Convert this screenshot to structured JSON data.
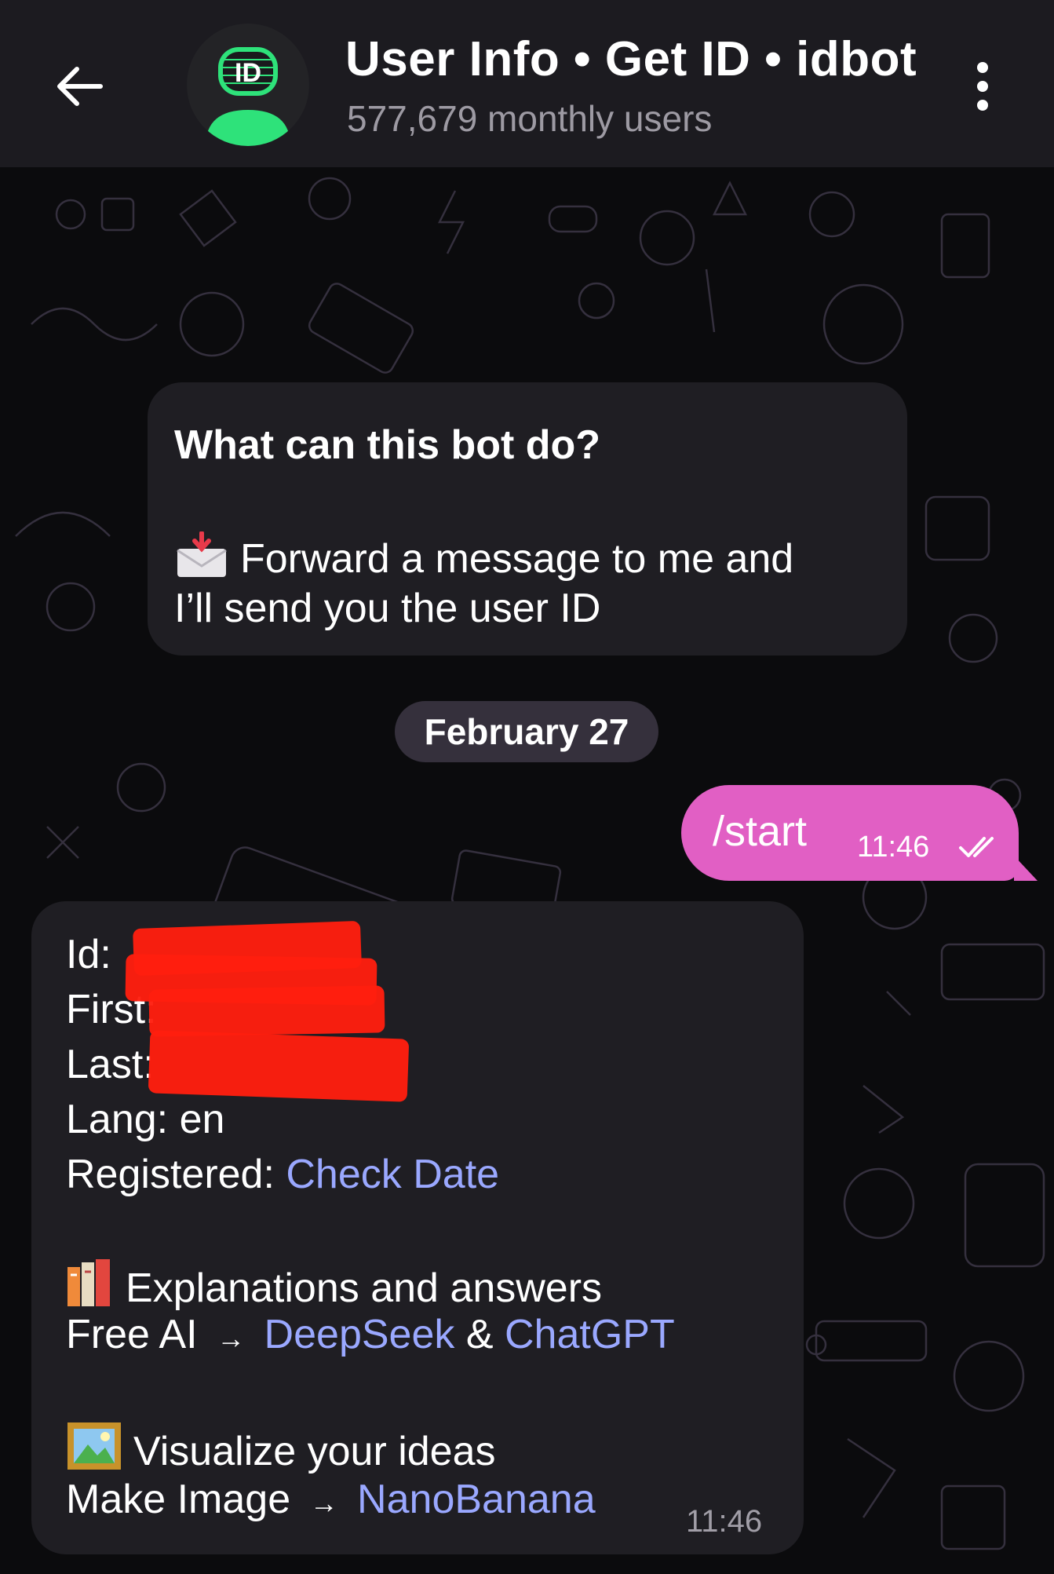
{
  "header": {
    "title": "User Info • Get ID • idbot",
    "subtitle": "577,679 monthly users",
    "avatar_text": "ID",
    "back_icon": "arrow-left-icon",
    "menu_icon": "more-vertical-icon"
  },
  "intro": {
    "title": "What can this bot do?",
    "line1": "Forward a message to me and",
    "line2": "I’ll send you the user ID",
    "icon": "envelope-arrow-icon"
  },
  "date_chip": "February 27",
  "outgoing": {
    "text": "/start",
    "time": "11:46",
    "status_icon": "double-check-icon"
  },
  "reply": {
    "id_label": "Id:",
    "first_label": "First:",
    "last_label": "Last:",
    "lang_label": "Lang: en",
    "registered_label": "Registered:",
    "registered_link": "Check Date",
    "explanations": "Explanations and answers",
    "free_ai_label": "Free AI",
    "arrow": "→",
    "deepseek_link": "DeepSeek",
    "amp": "&",
    "chatgpt_link": "ChatGPT",
    "visualize": "Visualize your ideas",
    "make_image_label": "Make Image",
    "nanobanana_link": "NanoBanana",
    "time": "11:46"
  },
  "colors": {
    "header_bg": "#1c1b20",
    "bubble_bg": "#1f1e23",
    "outgoing_bg": "#e15fc4",
    "link": "#9aa8ff",
    "date_chip_bg": "#35303c"
  }
}
